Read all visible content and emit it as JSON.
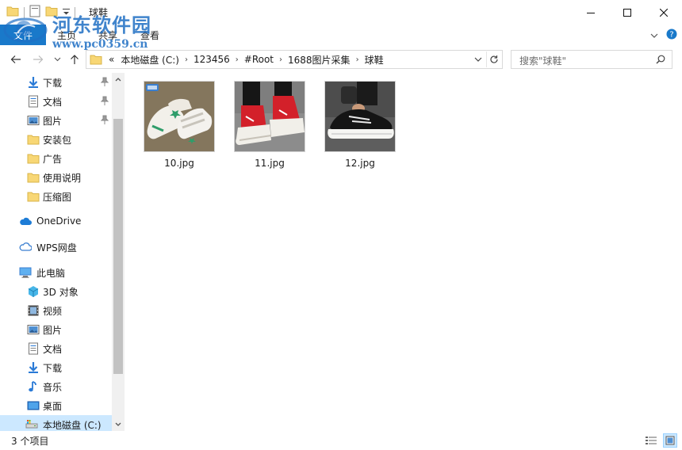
{
  "window": {
    "title": "球鞋"
  },
  "ribbon": {
    "file_tab": "文件",
    "tabs": [
      "主页",
      "共享",
      "查看"
    ]
  },
  "watermark": {
    "name": "河东软件园",
    "url": "www.pc0359.cn"
  },
  "address": {
    "overflow": "«",
    "crumbs": [
      "本地磁盘 (C:)",
      "123456",
      "#Root",
      "1688图片采集",
      "球鞋"
    ]
  },
  "search": {
    "placeholder": "搜索\"球鞋\""
  },
  "nav": {
    "quick": [
      {
        "label": "下载",
        "icon": "download-icon",
        "pinned": true
      },
      {
        "label": "文档",
        "icon": "document-icon",
        "pinned": true
      },
      {
        "label": "图片",
        "icon": "pictures-icon",
        "pinned": true
      },
      {
        "label": "安装包",
        "icon": "folder-icon",
        "pinned": false
      },
      {
        "label": "广告",
        "icon": "folder-icon",
        "pinned": false
      },
      {
        "label": "使用说明",
        "icon": "folder-icon",
        "pinned": false
      },
      {
        "label": "压缩图",
        "icon": "folder-icon",
        "pinned": false
      }
    ],
    "onedrive": "OneDrive",
    "wps": "WPS网盘",
    "pc": "此电脑",
    "pc_items": [
      {
        "label": "3D 对象",
        "icon": "3d-objects-icon"
      },
      {
        "label": "视频",
        "icon": "video-icon"
      },
      {
        "label": "图片",
        "icon": "pictures-icon"
      },
      {
        "label": "文档",
        "icon": "document-icon"
      },
      {
        "label": "下载",
        "icon": "download-icon"
      },
      {
        "label": "音乐",
        "icon": "music-icon"
      },
      {
        "label": "桌面",
        "icon": "desktop-icon"
      },
      {
        "label": "本地磁盘 (C:)",
        "icon": "drive-icon"
      }
    ]
  },
  "files": [
    {
      "name": "10.jpg"
    },
    {
      "name": "11.jpg"
    },
    {
      "name": "12.jpg"
    }
  ],
  "status": {
    "count_text": "3 个项目"
  },
  "colors": {
    "accent": "#1979ca",
    "selection": "#cce8ff",
    "folder": "#f8d775"
  }
}
